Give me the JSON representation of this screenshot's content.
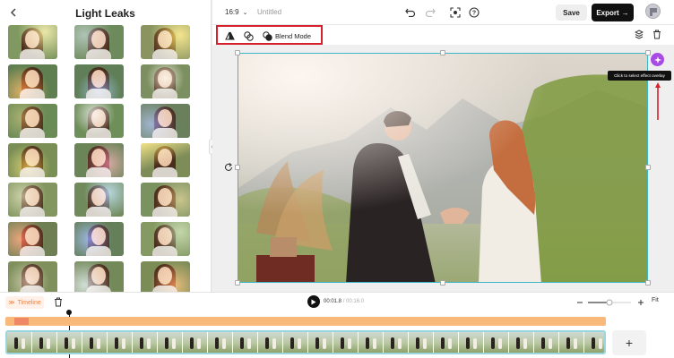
{
  "left_panel": {
    "title": "Light Leaks",
    "thumbnails": [
      {
        "leak": "radial-gradient(circle at 75% 20%, rgba(255,230,140,0.85), rgba(255,200,120,0) 60%)",
        "tone": "#7f9960"
      },
      {
        "leak": "radial-gradient(circle at 20% 30%, rgba(210,230,255,0.55), rgba(0,0,0,0) 60%)",
        "tone": "#6d8a5c"
      },
      {
        "leak": "radial-gradient(circle at 80% 30%, rgba(255,215,80,0.9), rgba(0,0,0,0) 65%)",
        "tone": "#8a9461"
      },
      {
        "leak": "radial-gradient(circle at 30% 80%, rgba(255,120,40,0.8), rgba(0,0,0,0) 60%)",
        "tone": "#5f7f50"
      },
      {
        "leak": "radial-gradient(circle at 50% 80%, rgba(120,170,255,0.7), rgba(0,0,0,0) 60%)",
        "tone": "#607f58"
      },
      {
        "leak": "radial-gradient(circle at 50% 40%, rgba(255,240,220,0.8), rgba(0,0,0,0) 60%)",
        "tone": "#7b8f60"
      },
      {
        "leak": "radial-gradient(circle at 30% 40%, rgba(255,190,90,0.45), rgba(0,0,0,0) 60%)",
        "tone": "#6a8a56"
      },
      {
        "leak": "radial-gradient(circle at 40% 30%, rgba(255,255,255,0.75), rgba(0,0,0,0) 55%)",
        "tone": "#6f8f5a"
      },
      {
        "leak": "radial-gradient(circle at 20% 60%, rgba(130,150,255,0.7), rgba(0,0,0,0) 60%)",
        "tone": "#6a7f5c"
      },
      {
        "leak": "radial-gradient(circle at 40% 70%, rgba(255,200,60,0.7), rgba(0,0,0,0) 60%)",
        "tone": "#7a8f55"
      },
      {
        "leak": "radial-gradient(circle at 70% 60%, rgba(255,110,160,0.7), rgba(0,0,0,0) 60%)",
        "tone": "#6b8458"
      },
      {
        "leak": "linear-gradient(160deg, rgba(255,210,80,0.9), rgba(0,0,0,0) 55%)",
        "tone": "#7e8d58"
      },
      {
        "leak": "radial-gradient(circle at 30% 40%, rgba(255,245,200,0.6), rgba(0,0,0,0) 60%)",
        "tone": "#83965f"
      },
      {
        "leak": "radial-gradient(circle at 70% 30%, rgba(160,210,255,0.8), rgba(0,0,0,0) 60%)",
        "tone": "#708a5c"
      },
      {
        "leak": "radial-gradient(circle at 80% 50%, rgba(255,200,120,0.6), rgba(0,0,0,0) 60%)",
        "tone": "#7a9160"
      },
      {
        "leak": "radial-gradient(circle at 25% 50%, rgba(255,90,70,0.85), rgba(0,0,0,0) 60%)",
        "tone": "#6f7f54"
      },
      {
        "leak": "radial-gradient(circle at 30% 50%, rgba(110,140,255,0.8), rgba(0,0,0,0) 60%)",
        "tone": "#657f5a"
      },
      {
        "leak": "radial-gradient(circle at 80% 30%, rgba(220,255,200,0.6), rgba(0,0,0,0) 60%)",
        "tone": "#849a62"
      },
      {
        "leak": "radial-gradient(circle at 40% 60%, rgba(255,220,200,0.6), rgba(0,0,0,0) 60%)",
        "tone": "#7f905c"
      },
      {
        "leak": "radial-gradient(circle at 20% 70%, rgba(230,245,255,0.75), rgba(0,0,0,0) 60%)",
        "tone": "#73895a"
      },
      {
        "leak": "radial-gradient(circle at 70% 70%, rgba(255,130,70,0.8), rgba(0,0,0,0) 60%)",
        "tone": "#7c8c57"
      }
    ]
  },
  "top_bar": {
    "ratio": "16:9",
    "document_title": "Untitled",
    "save_label": "Save",
    "export_label": "Export"
  },
  "toolbar": {
    "blend_mode_label": "Blend Mode"
  },
  "canvas": {
    "tooltip": "Click to select effect overlay"
  },
  "timeline": {
    "label": "Timeline",
    "current_time": "00:01.8",
    "separator": " / ",
    "duration": "00:16.0",
    "fit_label": "Fit",
    "zoom_level": 0.5,
    "frame_count": 24
  },
  "colors": {
    "highlight_border": "#d6212c",
    "accent_purple": "#a84ae6",
    "selection_cyan": "#3bb7c9",
    "timeline_orange": "#ee7f3b",
    "effect_track": "#f8b97a"
  }
}
